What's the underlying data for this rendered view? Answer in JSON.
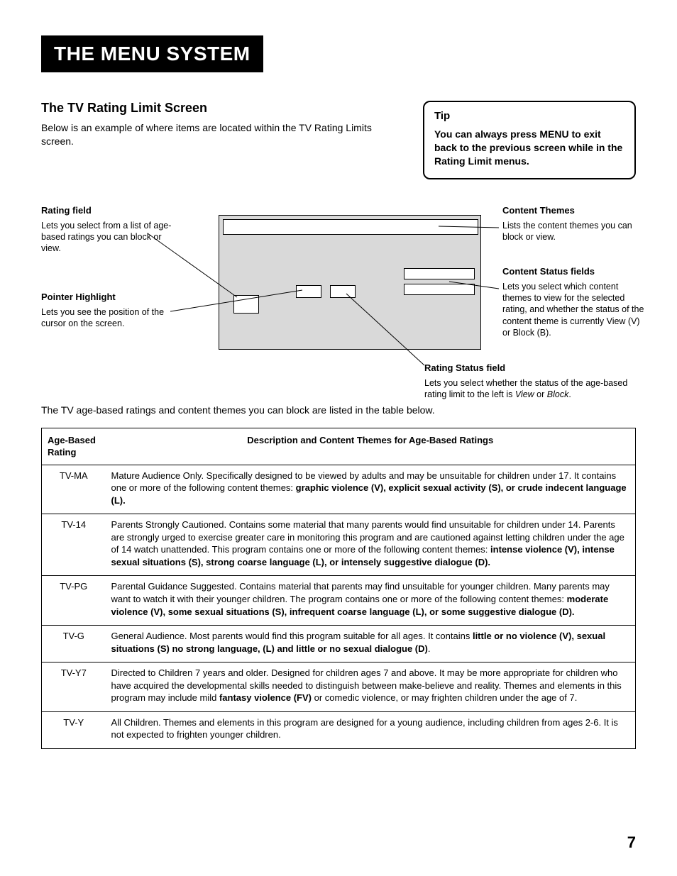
{
  "banner": "The Menu System",
  "heading": "The TV Rating Limit Screen",
  "intro": "Below is an example of where items are located within the TV Rating Limits screen.",
  "tip": {
    "title": "Tip",
    "body": "You can always press MENU to exit back to the previous screen while in the Rating Limit menus."
  },
  "callouts": {
    "rating_field": {
      "title": "Rating field",
      "body": "Lets you select from a list of age-based ratings you can block or view."
    },
    "pointer": {
      "title": "Pointer Highlight",
      "body": "Lets you see the position of the cursor on the screen."
    },
    "content_themes": {
      "title": "Content Themes",
      "body": "Lists the content themes you can block or view."
    },
    "content_status": {
      "title": "Content Status fields",
      "body": "Lets you select which content themes to view for the selected rating, and whether the status of the content theme is currently View (V) or Block (B)."
    },
    "rating_status": {
      "title": "Rating Status field",
      "body_pre": "Lets you select whether the status of the age-based rating limit to the left is ",
      "body_view": "View",
      "body_mid": " or ",
      "body_block": "Block",
      "body_post": "."
    }
  },
  "lead": "The TV age-based ratings and content themes you can block are listed in the table below.",
  "table": {
    "head_rating": "Age-Based Rating",
    "head_desc": "Description and Content Themes for Age-Based Ratings",
    "rows": [
      {
        "rating": "TV-MA",
        "pre": "Mature Audience Only. Specifically designed to be viewed by adults and may be unsuitable for children under 17.  It contains one or more of the following content themes:  ",
        "bold": "graphic violence (V), explicit sexual activity (S), or crude indecent language (L).",
        "post": ""
      },
      {
        "rating": "TV-14",
        "pre": "Parents Strongly Cautioned. Contains some material that many parents would find unsuitable for children under 14.  Parents are strongly urged to exercise greater care in monitoring this program and are cautioned against letting children under the age of 14 watch unattended.  This program contains one or more of the following content themes:  ",
        "bold": "intense violence (V), intense sexual situations (S), strong coarse language (L), or intensely suggestive dialogue (D).",
        "post": ""
      },
      {
        "rating": "TV-PG",
        "pre": "Parental Guidance Suggested. Contains material that parents may find unsuitable for younger children.  Many parents may want to watch it with their younger children.  The program contains one or more of the following content themes:  ",
        "bold": "moderate violence (V), some sexual situations (S), infrequent coarse language (L), or some suggestive dialogue (D).",
        "post": ""
      },
      {
        "rating": "TV-G",
        "pre": "General Audience. Most parents would find this program suitable for all ages.  It contains ",
        "bold": "little or no violence (V), sexual situations (S) no strong language, (L) and little or no sexual dialogue (D)",
        "post": "."
      },
      {
        "rating": "TV-Y7",
        "pre": "Directed to Children 7 years and older. Designed for children ages 7 and above.  It may be more appropriate for children who have acquired the developmental skills needed to distinguish between make-believe and reality.  Themes and elements in this program may include mild ",
        "bold": "fantasy violence (FV)",
        "post": " or comedic violence, or may frighten children under the age of 7."
      },
      {
        "rating": "TV-Y",
        "pre": "All Children. Themes and elements in this program are designed for a young audience, including children from ages 2-6.  It is not expected to frighten younger children.",
        "bold": "",
        "post": ""
      }
    ]
  },
  "page_number": "7"
}
